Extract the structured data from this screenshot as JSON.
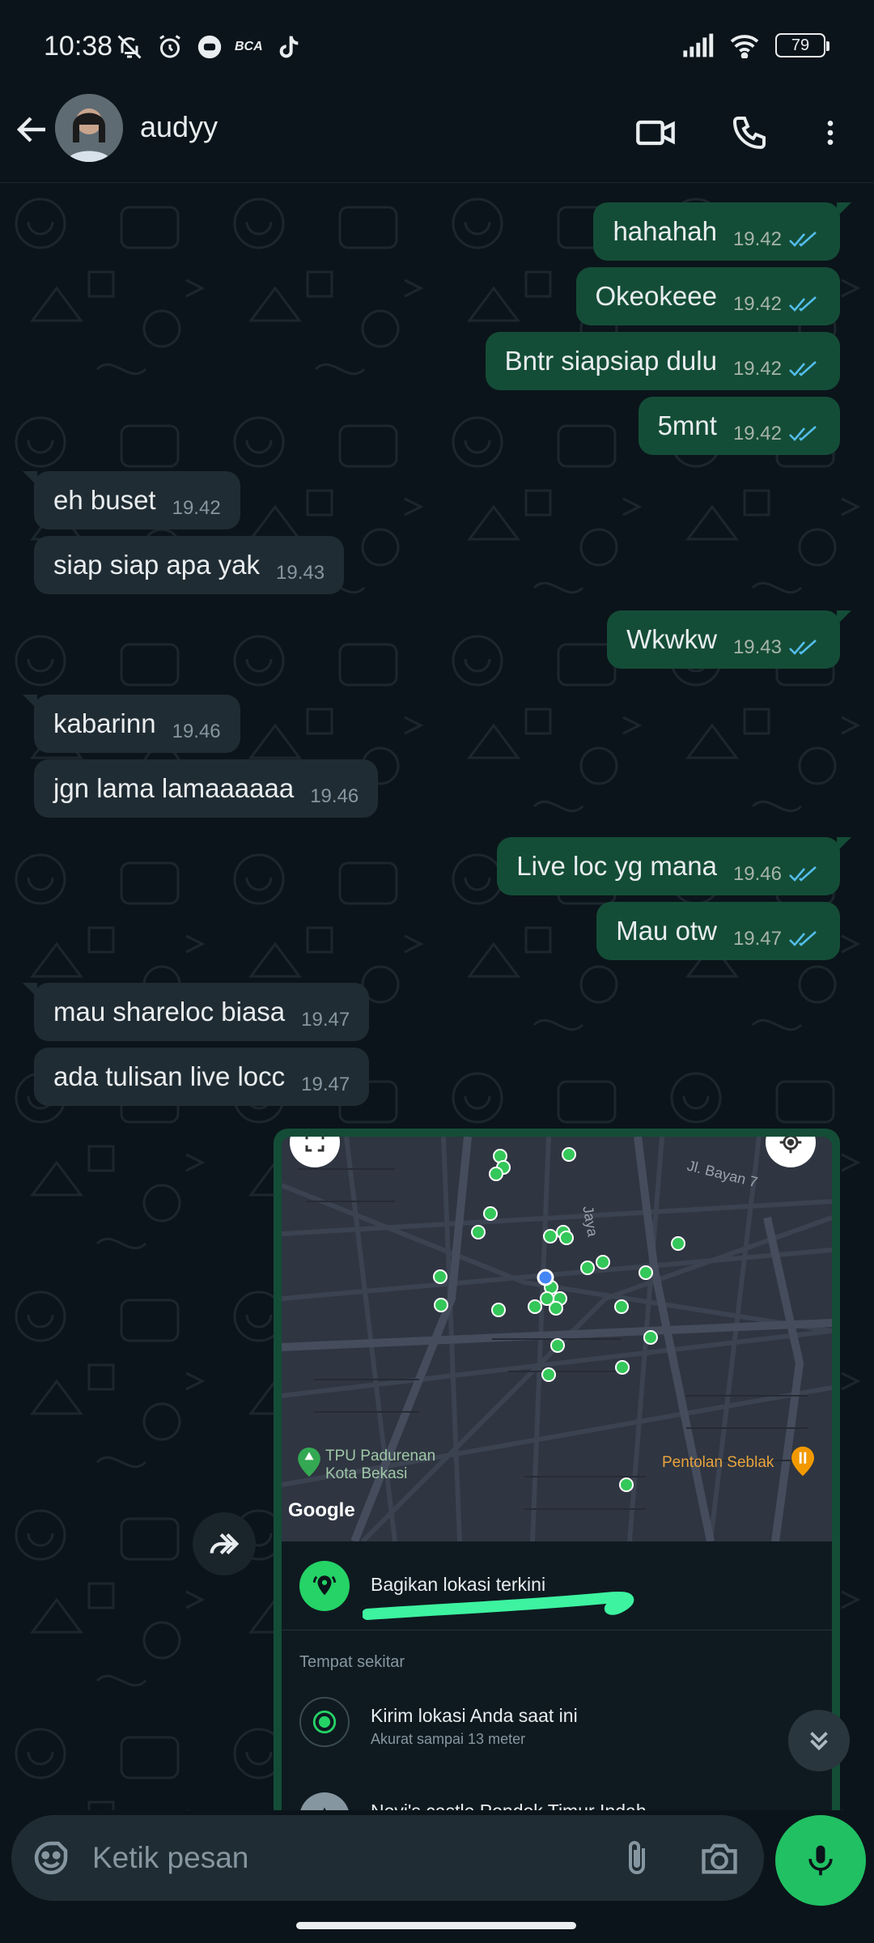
{
  "status_bar": {
    "time": "10:38",
    "battery": "79",
    "icons": [
      "mute-bell-icon",
      "alarm-icon",
      "messenger-icon",
      "bca-icon",
      "tiktok-icon",
      "signal-icon",
      "wifi-icon"
    ],
    "bca_label": "BCA"
  },
  "header": {
    "contact_name": "audyy",
    "actions": [
      "video-call",
      "voice-call",
      "more-options"
    ]
  },
  "messages": [
    {
      "dir": "out",
      "text": "hahahah",
      "time": "19.42",
      "read": true
    },
    {
      "dir": "out",
      "text": "Okeokeee",
      "time": "19.42",
      "read": true
    },
    {
      "dir": "out",
      "text": "Bntr siapsiap dulu",
      "time": "19.42",
      "read": true
    },
    {
      "dir": "out",
      "text": "5mnt",
      "time": "19.42",
      "read": true
    },
    {
      "dir": "in",
      "text": "eh buset",
      "time": "19.42"
    },
    {
      "dir": "in",
      "text": "siap siap apa yak",
      "time": "19.43"
    },
    {
      "dir": "out",
      "text": "Wkwkw",
      "time": "19.43",
      "read": true
    },
    {
      "dir": "in",
      "text": "kabarinn",
      "time": "19.46"
    },
    {
      "dir": "in",
      "text": "jgn lama lamaaaaaa",
      "time": "19.46"
    },
    {
      "dir": "out",
      "text": "Live loc yg mana",
      "time": "19.46",
      "read": true
    },
    {
      "dir": "out",
      "text": "Mau otw",
      "time": "19.47",
      "read": true
    },
    {
      "dir": "in",
      "text": "mau shareloc biasa",
      "time": "19.47"
    },
    {
      "dir": "in",
      "text": "ada tulisan live locc",
      "time": "19.47"
    }
  ],
  "location_card": {
    "map": {
      "street_label": "Jl. Bayan 7",
      "road_label": "Jaya",
      "poi_left": "TPU Padurenan\nKota Bekasi",
      "poi_right": "Pentolan Seblak",
      "provider": "Google"
    },
    "share_live": "Bagikan lokasi terkini",
    "nearby_section": "Tempat sekitar",
    "current_location": {
      "title": "Kirim lokasi Anda saat ini",
      "subtitle": "Akurat sampai 13 meter"
    },
    "place": "Novi's castle Pondok Timur Indah"
  },
  "composer": {
    "placeholder": "Ketik pesan"
  },
  "colors": {
    "background": "#0b141a",
    "outgoing_bubble": "#144d37",
    "incoming_bubble": "#202c33",
    "accent_green": "#21c063",
    "read_tick": "#53bdeb",
    "highlight_stroke": "#3df3a0"
  }
}
